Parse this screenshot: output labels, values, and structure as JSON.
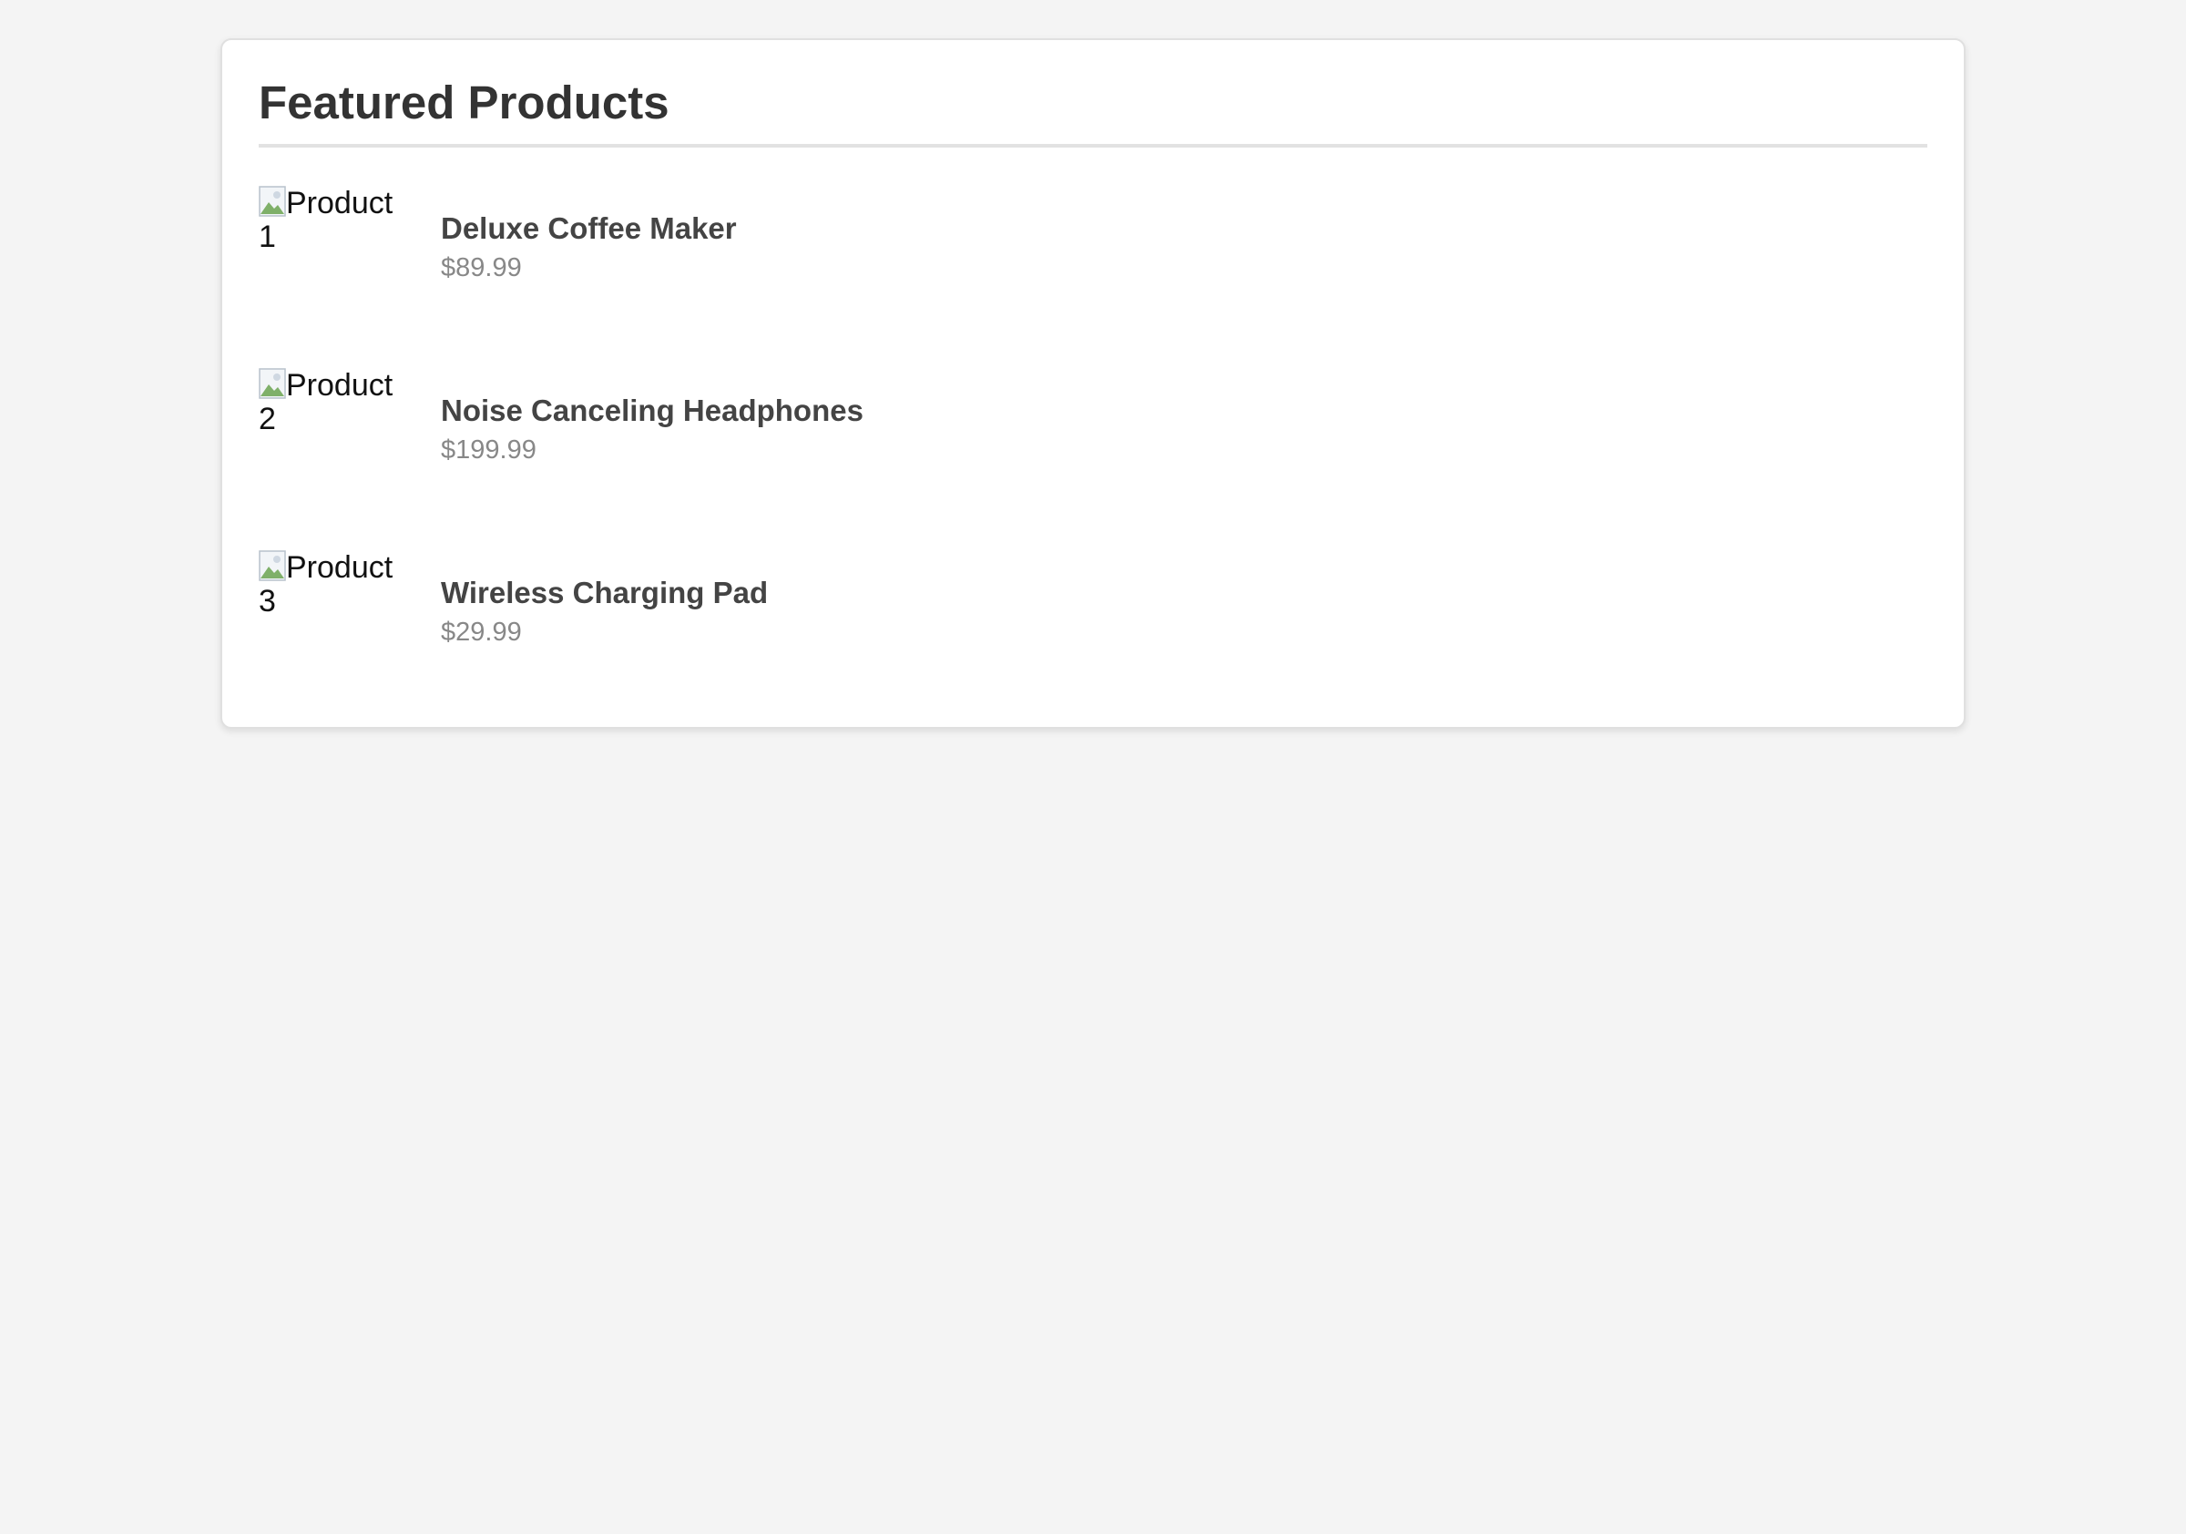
{
  "section": {
    "title": "Featured Products"
  },
  "products": [
    {
      "image_alt_line1": "Product",
      "image_alt_line2": "1",
      "name": "Deluxe Coffee Maker",
      "price": "$89.99"
    },
    {
      "image_alt_line1": "Product",
      "image_alt_line2": "2",
      "name": "Noise Canceling Headphones",
      "price": "$199.99"
    },
    {
      "image_alt_line1": "Product",
      "image_alt_line2": "3",
      "name": "Wireless Charging Pad",
      "price": "$29.99"
    }
  ],
  "icons": {
    "broken_image": "broken-image-icon"
  },
  "colors": {
    "background": "#f4f4f4",
    "card": "#ffffff",
    "title": "#333333",
    "product_name": "#444444",
    "price": "#888888"
  }
}
